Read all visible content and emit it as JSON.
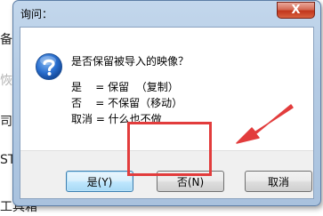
{
  "background": {
    "fragments": [
      "备份",
      "恢复",
      "司与",
      "ST",
      "工具箱"
    ]
  },
  "dialog": {
    "title": "询问：",
    "close_label": "X",
    "message": "是否保留被导入的映像？",
    "details": [
      "是    = 保留  （复制）",
      "否    = 不保留（移动）",
      "取消 = 什么也不做"
    ],
    "buttons": {
      "yes": "是(Y)",
      "no": "否(N)",
      "cancel": "取消"
    }
  },
  "annotation": {
    "highlight_color": "#e23c3c",
    "target": "no-button"
  },
  "icons": {
    "message_icon": "question-icon"
  }
}
